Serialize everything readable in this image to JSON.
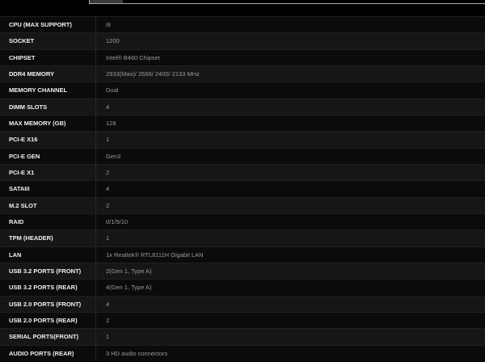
{
  "spec_rows": [
    {
      "label": "CPU (MAX SUPPORT)",
      "value": "i9"
    },
    {
      "label": "SOCKET",
      "value": "1200"
    },
    {
      "label": "CHIPSET",
      "value": "Intel® B460 Chipset"
    },
    {
      "label": "DDR4 MEMORY",
      "value": "2933(Max)/ 2666/ 2400/ 2133 MHz"
    },
    {
      "label": "MEMORY CHANNEL",
      "value": "Dual"
    },
    {
      "label": "DIMM SLOTS",
      "value": "4"
    },
    {
      "label": "MAX MEMORY (GB)",
      "value": "128"
    },
    {
      "label": "PCI-E X16",
      "value": "1"
    },
    {
      "label": "PCI-E GEN",
      "value": "Gen3"
    },
    {
      "label": "PCI-E X1",
      "value": "2"
    },
    {
      "label": "SATAIII",
      "value": "4"
    },
    {
      "label": "M.2 SLOT",
      "value": "2"
    },
    {
      "label": "RAID",
      "value": "0/1/5/10"
    },
    {
      "label": "TPM (HEADER)",
      "value": "1"
    },
    {
      "label": "LAN",
      "value": "1x Realtek® RTL8111H Gigabit LAN"
    },
    {
      "label": "USB 3.2 PORTS (FRONT)",
      "value": "2(Gen 1, Type A)"
    },
    {
      "label": "USB 3.2 PORTS (REAR)",
      "value": "4(Gen 1, Type A)"
    },
    {
      "label": "USB 2.0 PORTS (FRONT)",
      "value": "4"
    },
    {
      "label": "USB 2.0 PORTS (REAR)",
      "value": "2"
    },
    {
      "label": "SERIAL PORTS(FRONT)",
      "value": "1"
    },
    {
      "label": "AUDIO PORTS (REAR)",
      "value": "3 HD audio connectors"
    }
  ],
  "colors": {
    "background": "#000000",
    "row_dark": "#0b0b0b",
    "row_light": "#161616",
    "label_text": "#f2f2f2",
    "value_text": "#9a9a9a"
  }
}
